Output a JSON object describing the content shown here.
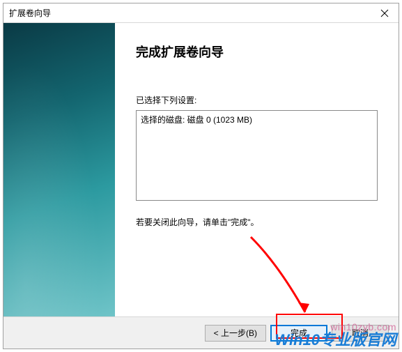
{
  "window": {
    "title": "扩展卷向导"
  },
  "main": {
    "heading": "完成扩展卷向导",
    "settings_label": "已选择下列设置:",
    "settings_content": "选择的磁盘: 磁盘 0 (1023 MB)",
    "close_hint": "若要关闭此向导，请单击\"完成\"。"
  },
  "buttons": {
    "back": "< 上一步(B)",
    "finish": "完成",
    "cancel": "取消"
  },
  "watermark": {
    "line1": "win10zyb.com",
    "line2_a": "Win10",
    "line2_b": "专业版官网"
  }
}
